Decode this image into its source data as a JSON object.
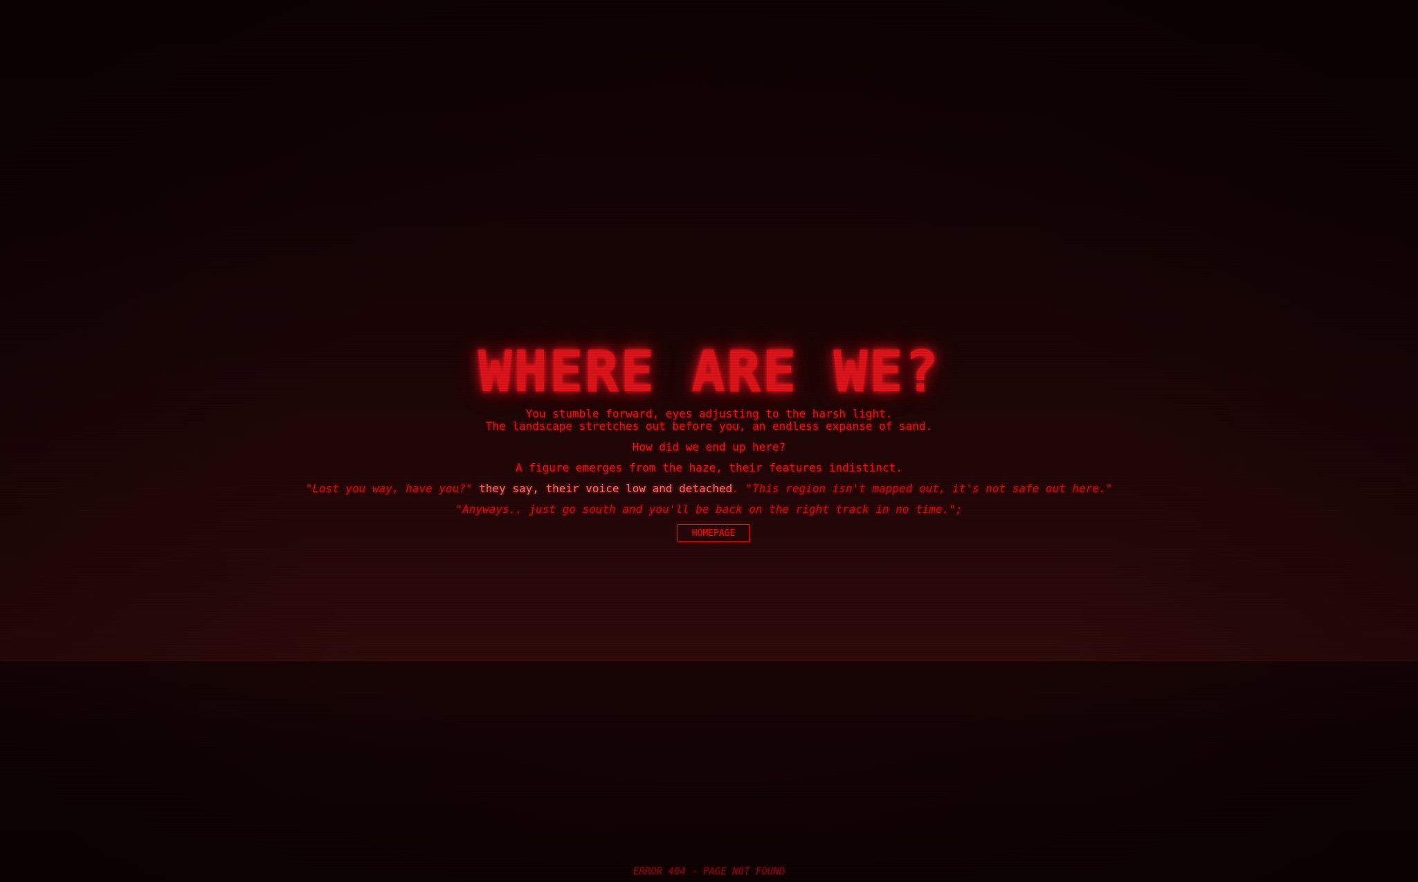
{
  "heading": "WHERE ARE WE?",
  "story": {
    "line1": "You stumble forward, eyes adjusting to the harsh light.",
    "line2": "The landscape stretches out before you, an endless expanse of sand.",
    "question": "How did we end up here?",
    "figure": "A figure emerges from the haze, their features indistinct.",
    "dialog": {
      "quote1": "\"Lost you way, have you?\"",
      "narration": " they say, their voice low and detached",
      "quote2": ". \"This region isn't mapped out, it's not safe out here.\""
    },
    "advice": "\"Anyways.. just go south and you'll be back on the right track in no time.\";"
  },
  "button": {
    "label": "HOMEPAGE"
  },
  "footer": {
    "error": "ERROR 404 - PAGE NOT FOUND"
  },
  "colors": {
    "accent": "#e0151b",
    "background": "#120203",
    "ground": "#140304"
  }
}
